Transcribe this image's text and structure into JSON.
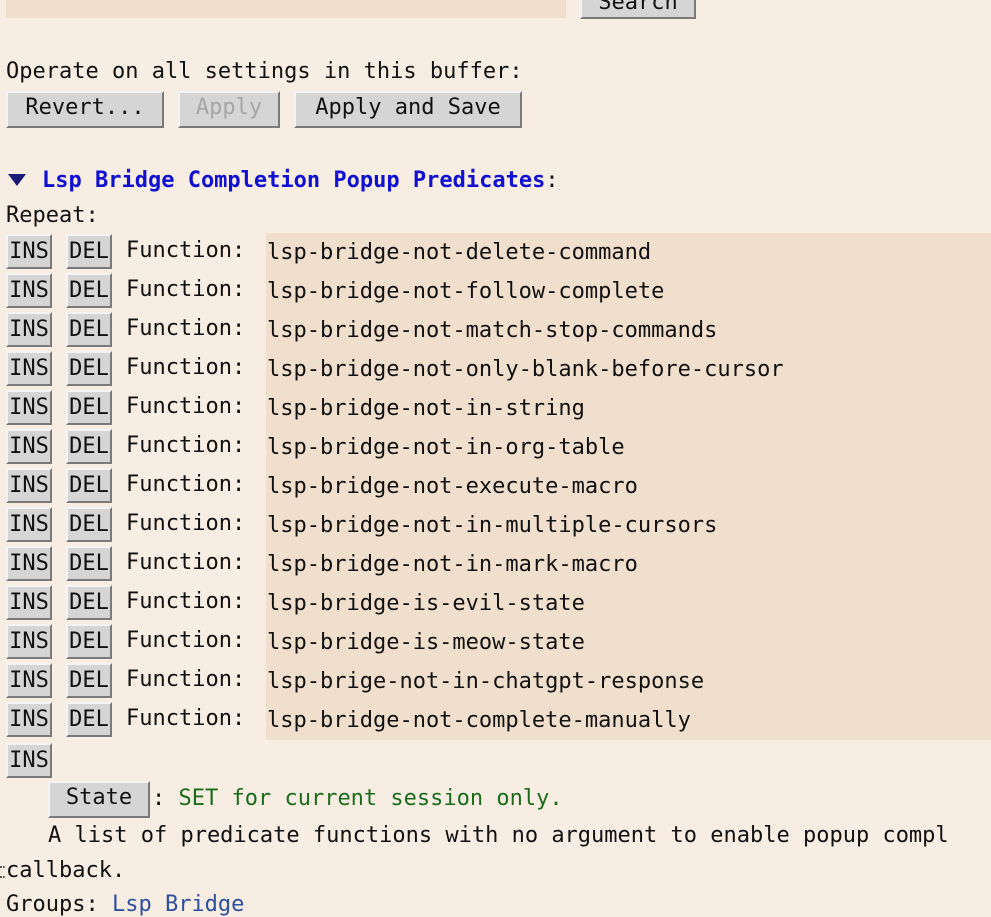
{
  "search": {
    "button_label": "Search"
  },
  "operate": {
    "label": "Operate on all settings in this buffer:",
    "revert_label": "Revert...",
    "apply_label": "Apply",
    "apply_save_label": "Apply and Save"
  },
  "group": {
    "title": "Lsp Bridge Completion Popup Predicates",
    "colon": ":"
  },
  "repeat_label": "Repeat:",
  "ins_label": "INS",
  "del_label": "DEL",
  "function_label": "Function:",
  "functions": [
    "lsp-bridge-not-delete-command",
    "lsp-bridge-not-follow-complete",
    "lsp-bridge-not-match-stop-commands",
    "lsp-bridge-not-only-blank-before-cursor",
    "lsp-bridge-not-in-string",
    "lsp-bridge-not-in-org-table",
    "lsp-bridge-not-execute-macro",
    "lsp-bridge-not-in-multiple-cursors",
    "lsp-bridge-not-in-mark-macro",
    "lsp-bridge-is-evil-state",
    "lsp-bridge-is-meow-state",
    "lsp-brige-not-in-chatgpt-response",
    "lsp-bridge-not-complete-manually"
  ],
  "state": {
    "button_label": "State",
    "separator": ":",
    "text": "SET for current session only."
  },
  "doc": {
    "line1": "A list of predicate functions with no argument to enable popup compl",
    "line2": "callback."
  },
  "groups": {
    "label": "Groups:",
    "link": "Lsp Bridge"
  },
  "colors": {
    "background": "#f7ede3",
    "field": "#f1dfcd",
    "title": "#1010d0",
    "state": "#1a6b1a",
    "link": "#2c4f9e"
  }
}
